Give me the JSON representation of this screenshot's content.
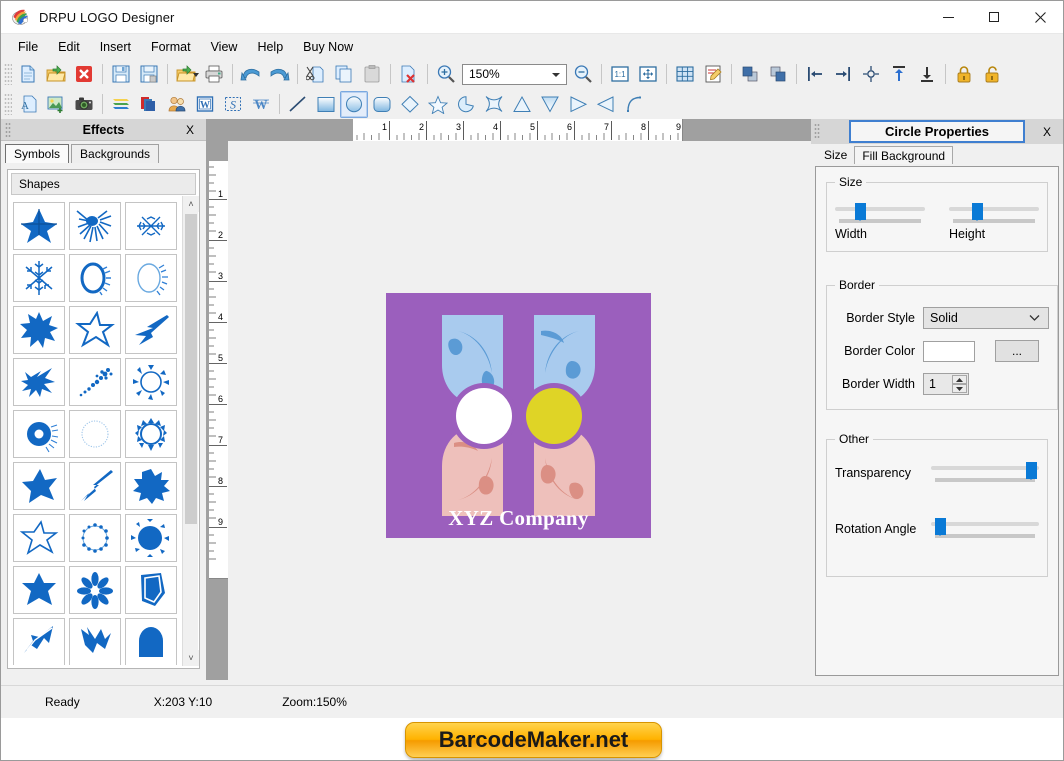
{
  "window": {
    "title": "DRPU LOGO Designer",
    "app_icon": "palette-icon",
    "minimize": "—",
    "maximize": "□",
    "close": "✕"
  },
  "menubar": {
    "items": [
      {
        "label": "File"
      },
      {
        "label": "Edit"
      },
      {
        "label": "Insert"
      },
      {
        "label": "Format"
      },
      {
        "label": "View"
      },
      {
        "label": "Help"
      },
      {
        "label": "Buy Now"
      }
    ]
  },
  "toolbar_row1": {
    "zoom_value": "150%",
    "buttons": [
      {
        "name": "new-document-icon",
        "title": "New"
      },
      {
        "name": "open-folder-icon",
        "title": "Open"
      },
      {
        "name": "close-document-icon",
        "title": "Close"
      },
      {
        "name": "save-icon",
        "title": "Save"
      },
      {
        "name": "save-as-icon",
        "title": "Save As"
      },
      {
        "name": "open-recent-icon",
        "title": "Open Recent"
      },
      {
        "name": "print-icon",
        "title": "Print"
      },
      {
        "name": "undo-icon",
        "title": "Undo"
      },
      {
        "name": "redo-icon",
        "title": "Redo"
      },
      {
        "name": "cut-icon",
        "title": "Cut"
      },
      {
        "name": "copy-icon",
        "title": "Copy"
      },
      {
        "name": "paste-icon",
        "title": "Paste"
      },
      {
        "name": "delete-icon",
        "title": "Delete"
      },
      {
        "name": "zoom-in-icon",
        "title": "Zoom In"
      },
      {
        "name": "zoom-out-icon",
        "title": "Zoom Out"
      },
      {
        "name": "actual-size-icon",
        "title": "1:1"
      },
      {
        "name": "fit-page-icon",
        "title": "Fit to Page"
      },
      {
        "name": "grid-icon",
        "title": "Show Grid"
      },
      {
        "name": "edit-design-icon",
        "title": "Edit"
      },
      {
        "name": "bring-front-icon",
        "title": "Bring To Front"
      },
      {
        "name": "send-back-icon",
        "title": "Send To Back"
      },
      {
        "name": "align-left-icon",
        "title": "Align Left"
      },
      {
        "name": "align-right-icon",
        "title": "Align Right"
      },
      {
        "name": "align-center-icon",
        "title": "Align Center"
      },
      {
        "name": "align-top-icon",
        "title": "Align Top"
      },
      {
        "name": "align-bottom-icon",
        "title": "Align Bottom"
      },
      {
        "name": "lock-icon",
        "title": "Lock"
      },
      {
        "name": "unlock-icon",
        "title": "Unlock"
      }
    ]
  },
  "toolbar_row2": {
    "selected": "circle-tool",
    "buttons": [
      {
        "name": "text-tool-icon",
        "title": "Text"
      },
      {
        "name": "image-tool-icon",
        "title": "Image"
      },
      {
        "name": "camera-tool-icon",
        "title": "Capture"
      },
      {
        "name": "layers-tool-icon",
        "title": "Layers"
      },
      {
        "name": "background-tool-icon",
        "title": "Background"
      },
      {
        "name": "symbols-tool-icon",
        "title": "Symbols"
      },
      {
        "name": "word-art-tool-icon",
        "title": "Word Art"
      },
      {
        "name": "signature-tool-icon",
        "title": "Signature"
      },
      {
        "name": "watermark-tool-icon",
        "title": "Watermark"
      },
      {
        "name": "line-tool-icon",
        "title": "Line"
      },
      {
        "name": "rectangle-tool-icon",
        "title": "Rectangle"
      },
      {
        "name": "circle-tool-icon",
        "title": "Circle"
      },
      {
        "name": "rounded-rect-tool-icon",
        "title": "Rounded Rectangle"
      },
      {
        "name": "diamond-tool-icon",
        "title": "Diamond"
      },
      {
        "name": "star-tool-icon",
        "title": "Star"
      },
      {
        "name": "pie-tool-icon",
        "title": "Pie"
      },
      {
        "name": "four-point-star-tool-icon",
        "title": "4 Point Star"
      },
      {
        "name": "triangle-up-tool-icon",
        "title": "Triangle Up"
      },
      {
        "name": "triangle-down-tool-icon",
        "title": "Triangle Down"
      },
      {
        "name": "triangle-right-tool-icon",
        "title": "Triangle Right"
      },
      {
        "name": "triangle-left-tool-icon",
        "title": "Triangle Left"
      },
      {
        "name": "arc-tool-icon",
        "title": "Arc"
      }
    ]
  },
  "effects_panel": {
    "title": "Effects",
    "close_label": "X",
    "tabs": [
      {
        "label": "Symbols",
        "active": true
      },
      {
        "label": "Backgrounds",
        "active": false
      }
    ],
    "category": "Shapes",
    "scroll_up": "˄",
    "scroll_down": "˅",
    "shape_names": [
      "star-5-point-shape",
      "burst-rays-shape",
      "snowflake-small-shape",
      "snowflake-shape",
      "oval-ring-shape",
      "oval-ring-spiked-shape",
      "star-8-point-shape",
      "star-outline-tilted-shape",
      "spike-arrow-shape",
      "splash-shape",
      "dotted-trail-shape",
      "sun-burst-shape",
      "donut-radial-shape",
      "faint-circle-shape",
      "gear-circle-shape",
      "star-5-solid-shape",
      "arrow-spike-shape",
      "star-10-solid-shape",
      "star-outline-5-shape",
      "circle-dotted-ring-shape",
      "circle-sunburst-solid-shape",
      "star-6-solid-shape",
      "flower-petals-shape",
      "cone-shape",
      "arrow-outline-shape",
      "zigzag-shape",
      "dome-shape"
    ]
  },
  "rulers": {
    "horizontal_ticks": [
      "1",
      "2",
      "3",
      "4",
      "5",
      "6",
      "7",
      "8",
      "9"
    ],
    "vertical_ticks": [
      "1",
      "2",
      "3",
      "4",
      "5",
      "6",
      "7",
      "8",
      "9"
    ]
  },
  "canvas": {
    "logo": {
      "company_text": "XYZ Company",
      "background_color": "#9b5fbd",
      "leaf_blue_color": "#a9cbee",
      "leaf_blue_accent": "#5b9bd5",
      "leaf_pink_color": "#eec0bb",
      "leaf_pink_accent": "#db8f84",
      "circle_white_color": "#ffffff",
      "circle_yellow_color": "#dfd426"
    }
  },
  "properties_panel": {
    "title": "Circle Properties",
    "close_label": "X",
    "tabs": [
      {
        "label": "Size",
        "active": true
      },
      {
        "label": "Fill Background",
        "active": false
      }
    ],
    "size_group": {
      "legend": "Size",
      "width_label": "Width",
      "height_label": "Height",
      "width_value": 22,
      "height_value": 26
    },
    "border_group": {
      "legend": "Border",
      "style_label": "Border Style",
      "style_value": "Solid",
      "color_label": "Border Color",
      "color_value": "#ffffff",
      "browse_label": "...",
      "width_label": "Border Width",
      "width_value": "1"
    },
    "other_group": {
      "legend": "Other",
      "transparency_label": "Transparency",
      "transparency_value": 100,
      "rotation_label": "Rotation Angle",
      "rotation_value": 5
    }
  },
  "statusbar": {
    "status": "Ready",
    "coords": "X:203  Y:10",
    "zoom": "Zoom:150%"
  },
  "footer": {
    "banner_text": "BarcodeMaker.net"
  }
}
